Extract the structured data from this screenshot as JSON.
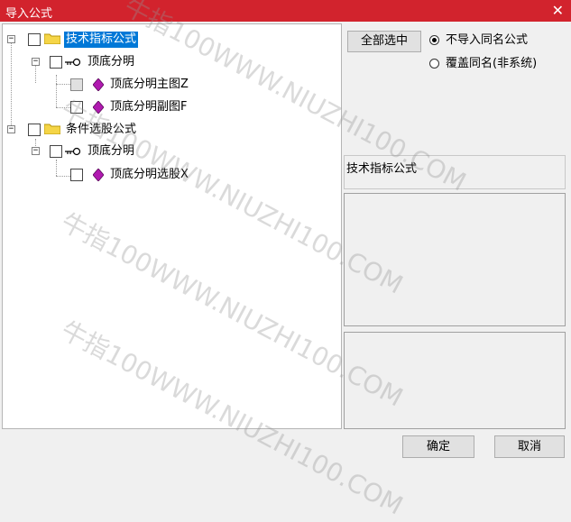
{
  "window": {
    "title": "导入公式",
    "close_glyph": "✕"
  },
  "tree": {
    "nodes": [
      {
        "label": "技术指标公式",
        "expander": "−",
        "selected": true
      },
      {
        "label": "顶底分明",
        "expander": "−"
      },
      {
        "label": "顶底分明主图Z"
      },
      {
        "label": "顶底分明副图F"
      },
      {
        "label": "条件选股公式",
        "expander": "−"
      },
      {
        "label": "顶底分明",
        "expander": "−"
      },
      {
        "label": "顶底分明选股X"
      }
    ]
  },
  "right": {
    "select_all_label": "全部选中",
    "options": [
      {
        "label": "不导入同名公式",
        "checked": true
      },
      {
        "label": "覆盖同名(非系统)",
        "checked": false
      }
    ],
    "category_label": "技术指标公式"
  },
  "footer": {
    "ok_label": "确定",
    "cancel_label": "取消"
  },
  "watermark": "牛指100WWW.NIUZHI100.COM",
  "colors": {
    "titlebar": "#d2232d",
    "selection": "#0078d7",
    "gem": "#b01ab0",
    "folder": "#f5d547"
  }
}
